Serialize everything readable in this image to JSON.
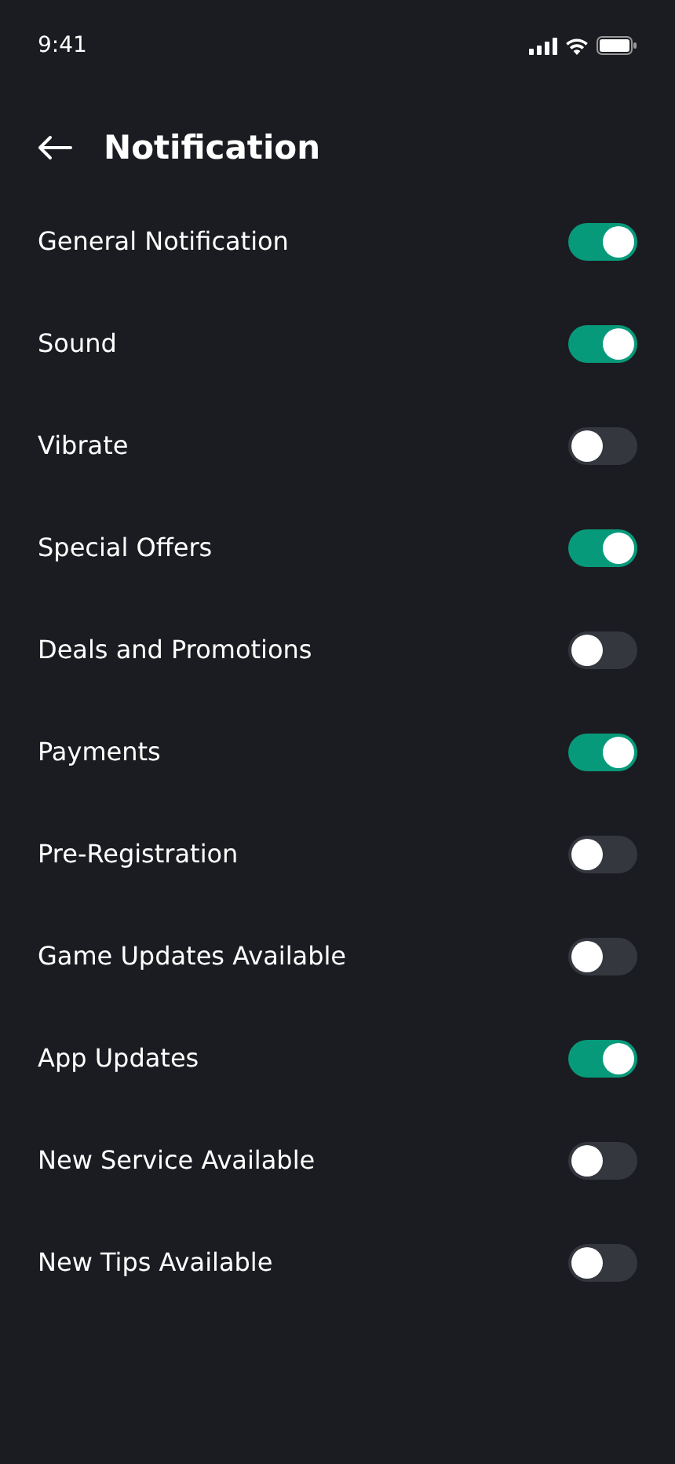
{
  "status_bar": {
    "time": "9:41"
  },
  "header": {
    "title": "Notification"
  },
  "settings": [
    {
      "label": "General Notification",
      "on": true
    },
    {
      "label": "Sound",
      "on": true
    },
    {
      "label": "Vibrate",
      "on": false
    },
    {
      "label": "Special Offers",
      "on": true
    },
    {
      "label": "Deals and Promotions",
      "on": false
    },
    {
      "label": "Payments",
      "on": true
    },
    {
      "label": "Pre-Registration",
      "on": false
    },
    {
      "label": "Game Updates Available",
      "on": false
    },
    {
      "label": "App Updates",
      "on": true
    },
    {
      "label": "New Service Available",
      "on": false
    },
    {
      "label": "New Tips Available",
      "on": false
    }
  ]
}
